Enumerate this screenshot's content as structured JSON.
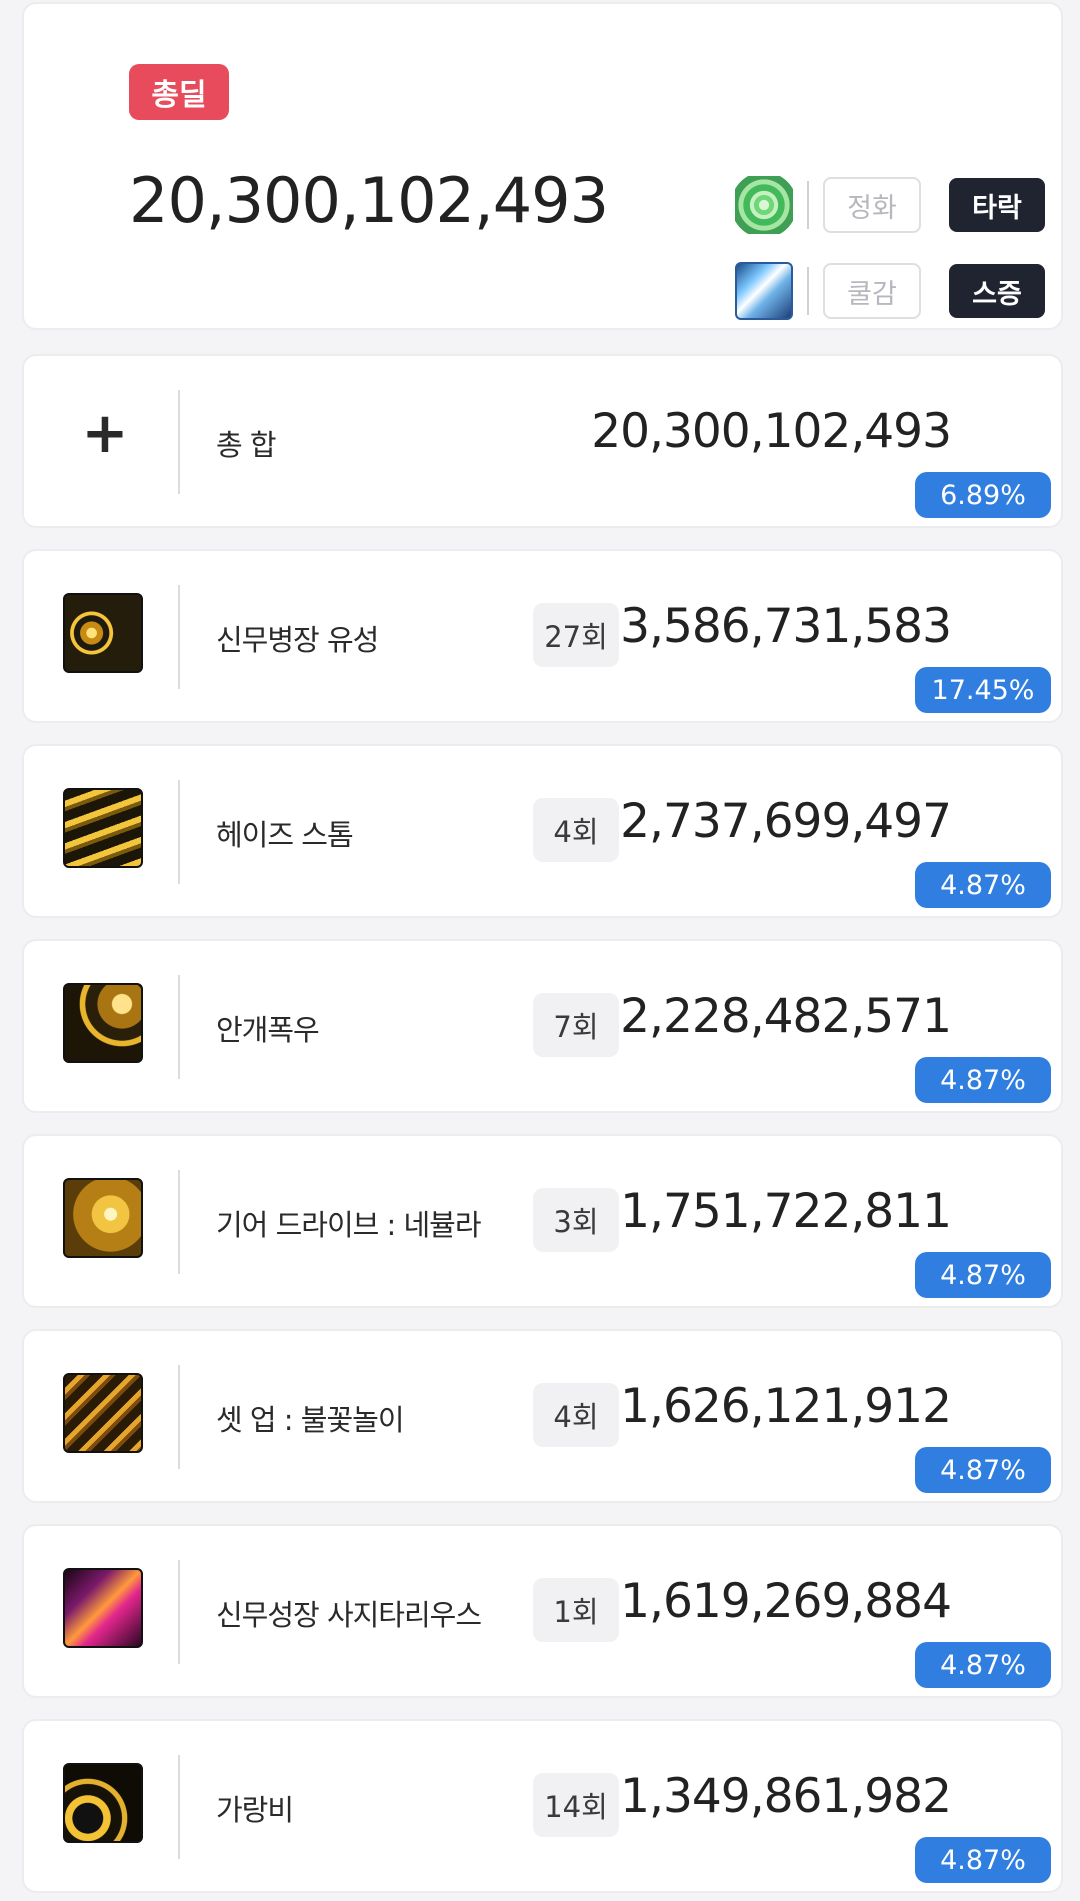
{
  "summary": {
    "badge": "총딜",
    "total": "20,300,102,493",
    "options": [
      {
        "icon": "rose-icon",
        "off_label": "정화",
        "on_label": "타락"
      },
      {
        "icon": "gear-icon",
        "off_label": "쿨감",
        "on_label": "스증"
      }
    ]
  },
  "total_row": {
    "icon": "plus-icon",
    "name": "총 합",
    "value": "20,300,102,493",
    "percent": "6.89%"
  },
  "skills": [
    {
      "name": "신무병장 유성",
      "count": "27회",
      "value": "3,586,731,583",
      "percent": "17.45%"
    },
    {
      "name": "헤이즈 스톰",
      "count": "4회",
      "value": "2,737,699,497",
      "percent": "4.87%"
    },
    {
      "name": "안개폭우",
      "count": "7회",
      "value": "2,228,482,571",
      "percent": "4.87%"
    },
    {
      "name": "기어 드라이브 : 네뷸라",
      "count": "3회",
      "value": "1,751,722,811",
      "percent": "4.87%"
    },
    {
      "name": "셋 업 : 불꽃놀이",
      "count": "4회",
      "value": "1,626,121,912",
      "percent": "4.87%"
    },
    {
      "name": "신무성장 사지타리우스",
      "count": "1회",
      "value": "1,619,269,884",
      "percent": "4.87%"
    },
    {
      "name": "가랑비",
      "count": "14회",
      "value": "1,349,861,982",
      "percent": "4.87%"
    }
  ],
  "colors": {
    "badge_red": "#e84b5c",
    "percent_blue": "#2f7ee0",
    "toggle_dark": "#1f2430"
  }
}
